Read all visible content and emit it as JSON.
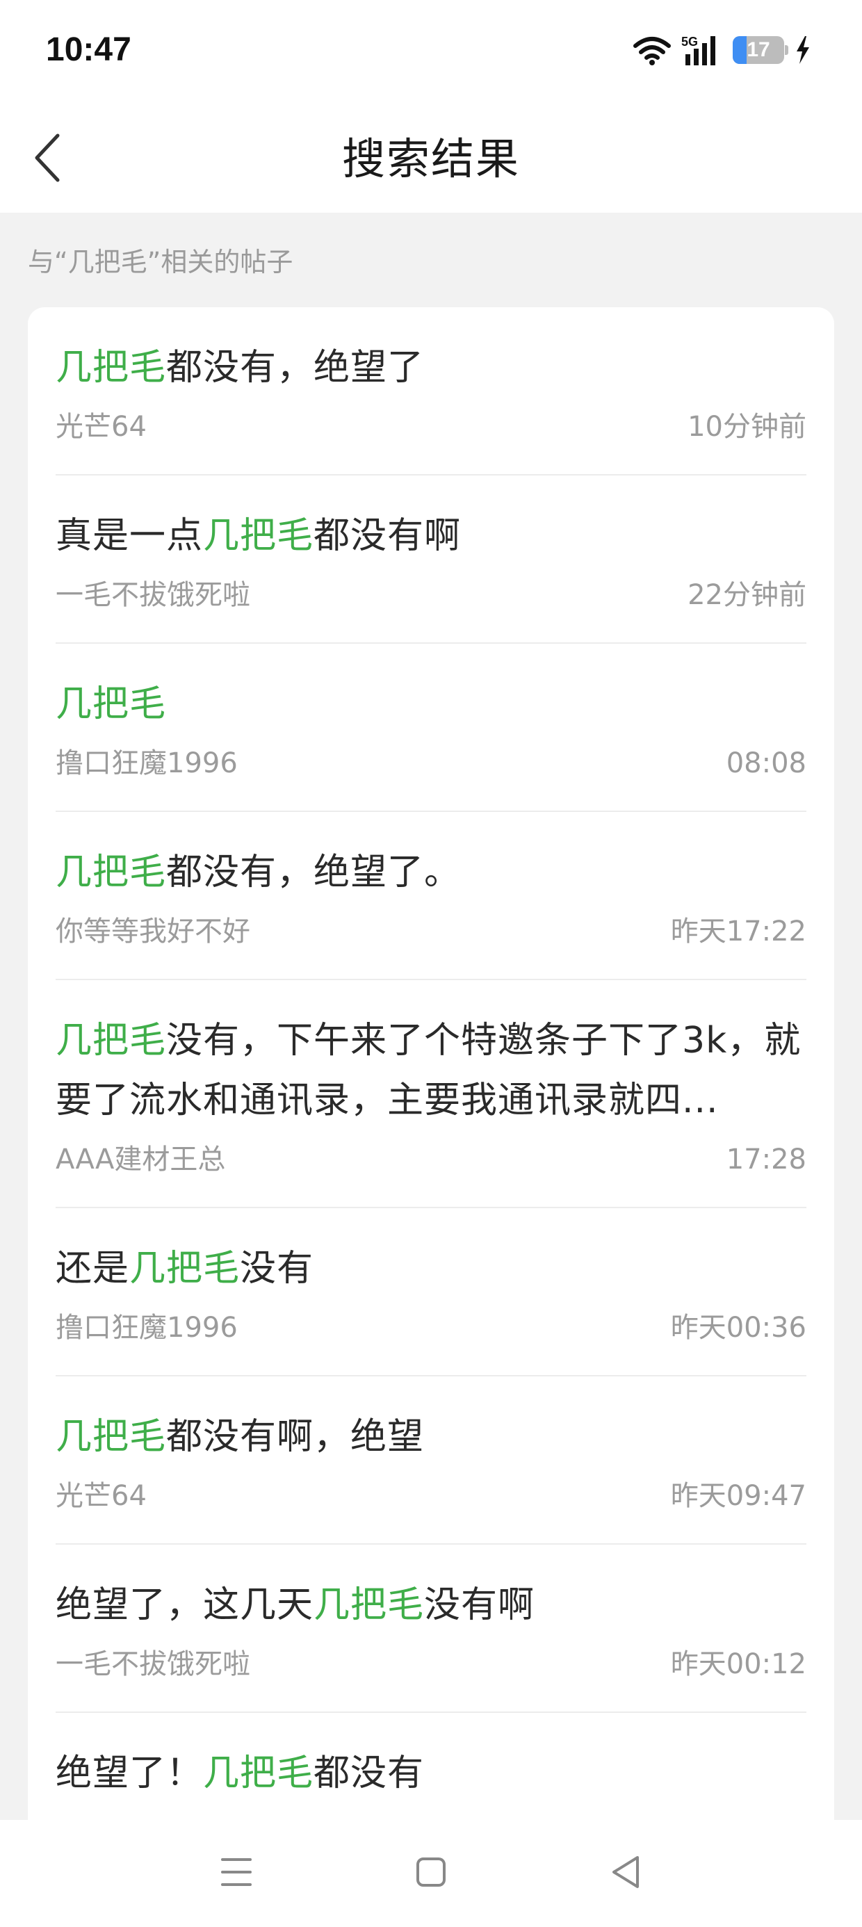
{
  "status_bar": {
    "time": "10:47",
    "network": "5G",
    "battery_level": "17",
    "icons": [
      "wifi-icon",
      "signal-5g-icon",
      "battery-icon",
      "charging-icon"
    ]
  },
  "header": {
    "title": "搜索结果",
    "back_icon": "chevron-left-icon"
  },
  "section_label": "与“几把毛”相关的帖子",
  "highlight_color": "#3fae49",
  "results": [
    {
      "before": "",
      "highlight": "几把毛",
      "after": "都没有，绝望了",
      "author": "光芒64",
      "time": "10分钟前"
    },
    {
      "before": "真是一点",
      "highlight": "几把毛",
      "after": "都没有啊",
      "author": "一毛不拔饿死啦",
      "time": "22分钟前"
    },
    {
      "before": "",
      "highlight": "几把毛",
      "after": "",
      "author": "撸口狂魔1996",
      "time": "08:08"
    },
    {
      "before": "",
      "highlight": "几把毛",
      "after": "都没有，绝望了。",
      "author": "你等等我好不好",
      "time": "昨天17:22"
    },
    {
      "before": "",
      "highlight": "几把毛",
      "after": "没有，下午来了个特邀条子下了3k，就要了流水和通讯录，主要我通讯录就四...",
      "author": "AAA建材王总",
      "time": "17:28"
    },
    {
      "before": "还是",
      "highlight": "几把毛",
      "after": "没有",
      "author": "撸口狂魔1996",
      "time": "昨天00:36"
    },
    {
      "before": "",
      "highlight": "几把毛",
      "after": "都没有啊，绝望",
      "author": "光芒64",
      "time": "昨天09:47"
    },
    {
      "before": "绝望了，这几天",
      "highlight": "几把毛",
      "after": "没有啊",
      "author": "一毛不拔饿死啦",
      "time": "昨天00:12"
    },
    {
      "before": "绝望了！",
      "highlight": "几把毛",
      "after": "都没有",
      "author": "",
      "time": ""
    }
  ],
  "nav_bar": {
    "icons": [
      "menu-icon",
      "home-square-icon",
      "back-triangle-icon"
    ]
  }
}
